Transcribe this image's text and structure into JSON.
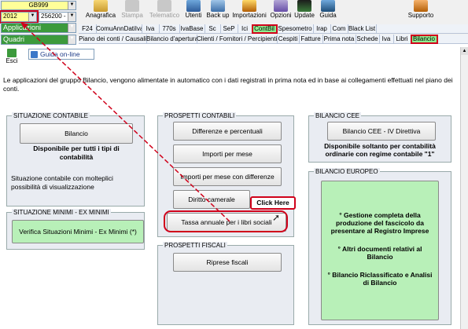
{
  "header": {
    "user_select": "GB999",
    "year_select": "2012",
    "company_select": "256200 -",
    "module_select": "Applicazioni",
    "submodule_select": "Quadri"
  },
  "toolbar": [
    {
      "label": "Anagrafica",
      "icon": "contacts-icon",
      "enabled": true
    },
    {
      "label": "Stampa",
      "icon": "printer-icon",
      "enabled": false
    },
    {
      "label": "Telematico",
      "icon": "telematic-icon",
      "enabled": false
    },
    {
      "label": "Utenti",
      "icon": "users-icon",
      "enabled": true
    },
    {
      "label": "Back up",
      "icon": "backup-icon",
      "enabled": true
    },
    {
      "label": "Importazioni",
      "icon": "import-icon",
      "enabled": true
    },
    {
      "label": "Opzioni",
      "icon": "options-icon",
      "enabled": true
    },
    {
      "label": "Update",
      "icon": "update-icon",
      "enabled": true
    },
    {
      "label": "Guida",
      "icon": "help-icon",
      "enabled": true
    }
  ],
  "support_label": "Supporto",
  "tabs_row1": [
    "F24",
    "ComuAnnDatiIva",
    "Iva",
    "770s",
    "IvaBase",
    "Sc",
    "SeP",
    "Ici",
    "ContBil",
    "Spesometro",
    "Irap",
    "Com",
    "Black List"
  ],
  "tabs_row2": [
    "Piano dei conti / Causali",
    "Bilancio d'apertura",
    "Clienti / Fornitori / Percipienti",
    "Cespiti",
    "Fatture",
    "Prima nota",
    "Schede",
    "Iva",
    "Libri",
    "Bilancio"
  ],
  "exit_label": "Esci",
  "help_online_label": "Guida on-line",
  "intro": "Le applicazioni del gruppo Bilancio, vengono alimentate in automatico con i dati registrati in prima nota ed in base ai collegamenti effettuati nel piano dei conti.",
  "situazione_contabile": {
    "title": "SITUAZIONE CONTABILE",
    "button": "Bilancio",
    "bold_note": "Disponibile per tutti i tipi di contabilità",
    "note": "Situazione contabile con molteplici possibilità di visualizzazione"
  },
  "situazione_minimi": {
    "title": "SITUAZIONE MINIMI - EX MINIMI",
    "button": "Verifica Situazioni Minimi - Ex Minimi (*)"
  },
  "prospetti_contabili": {
    "title": "PROSPETTI CONTABILI",
    "buttons": [
      "Differenze e percentuali",
      "Importi per mese",
      "Importi per mese con differenze",
      "Diritto camerale",
      "Tassa annuale per i libri sociali"
    ]
  },
  "click_here_label": "Click Here",
  "prospetti_fiscali": {
    "title": "PROSPETTI FISCALI",
    "button": "Riprese fiscali"
  },
  "bilancio_cee": {
    "title": "BILANCIO CEE",
    "button": "Bilancio CEE - IV Direttiva",
    "bold_note": "Disponibile soltanto per contabilità ordinarie con regime contabile \"1\""
  },
  "bilancio_europeo": {
    "title": "BILANCIO EUROPEO",
    "items": [
      "° Gestione completa della produzione del fascicolo da presentare al Registro Imprese",
      "° Altri documenti relativi al Bilancio",
      "° Bilancio Riclassificato e Analisi di Bilancio"
    ]
  },
  "colors": {
    "highlight_green": "#90ee90",
    "annotation_red": "#d0021b",
    "panel_bg": "#e9ecf2"
  }
}
